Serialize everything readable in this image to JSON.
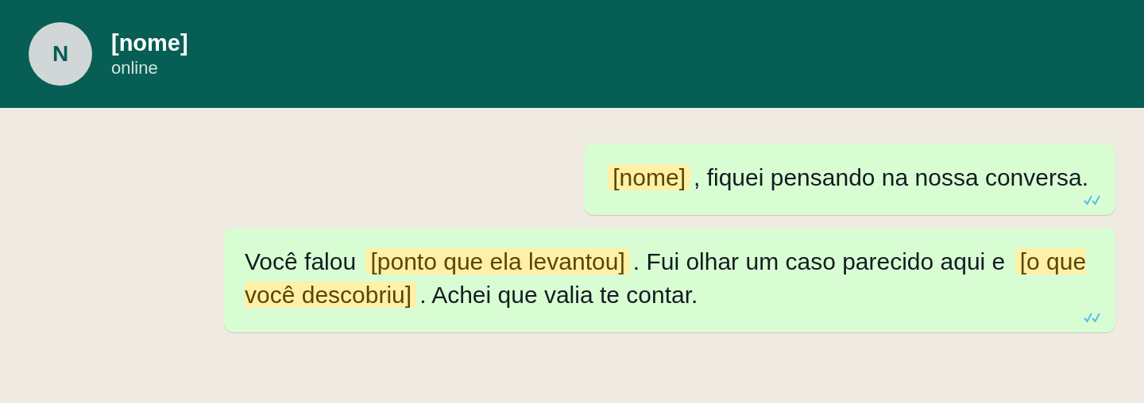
{
  "contact": {
    "initial": "N",
    "name": "[nome]",
    "status": "online"
  },
  "messages": [
    {
      "read": true,
      "segments": [
        {
          "kind": "placeholder",
          "text": "[nome]"
        },
        {
          "kind": "text",
          "text": ", fiquei pensando na nossa conversa."
        }
      ]
    },
    {
      "read": true,
      "segments": [
        {
          "kind": "text",
          "text": "Você falou "
        },
        {
          "kind": "placeholder",
          "text": "[ponto que ela levantou]"
        },
        {
          "kind": "text",
          "text": ". Fui olhar um caso parecido aqui e "
        },
        {
          "kind": "placeholder",
          "text": "[o que você descobriu]"
        },
        {
          "kind": "text",
          "text": ". Achei que valia te contar."
        }
      ]
    }
  ]
}
